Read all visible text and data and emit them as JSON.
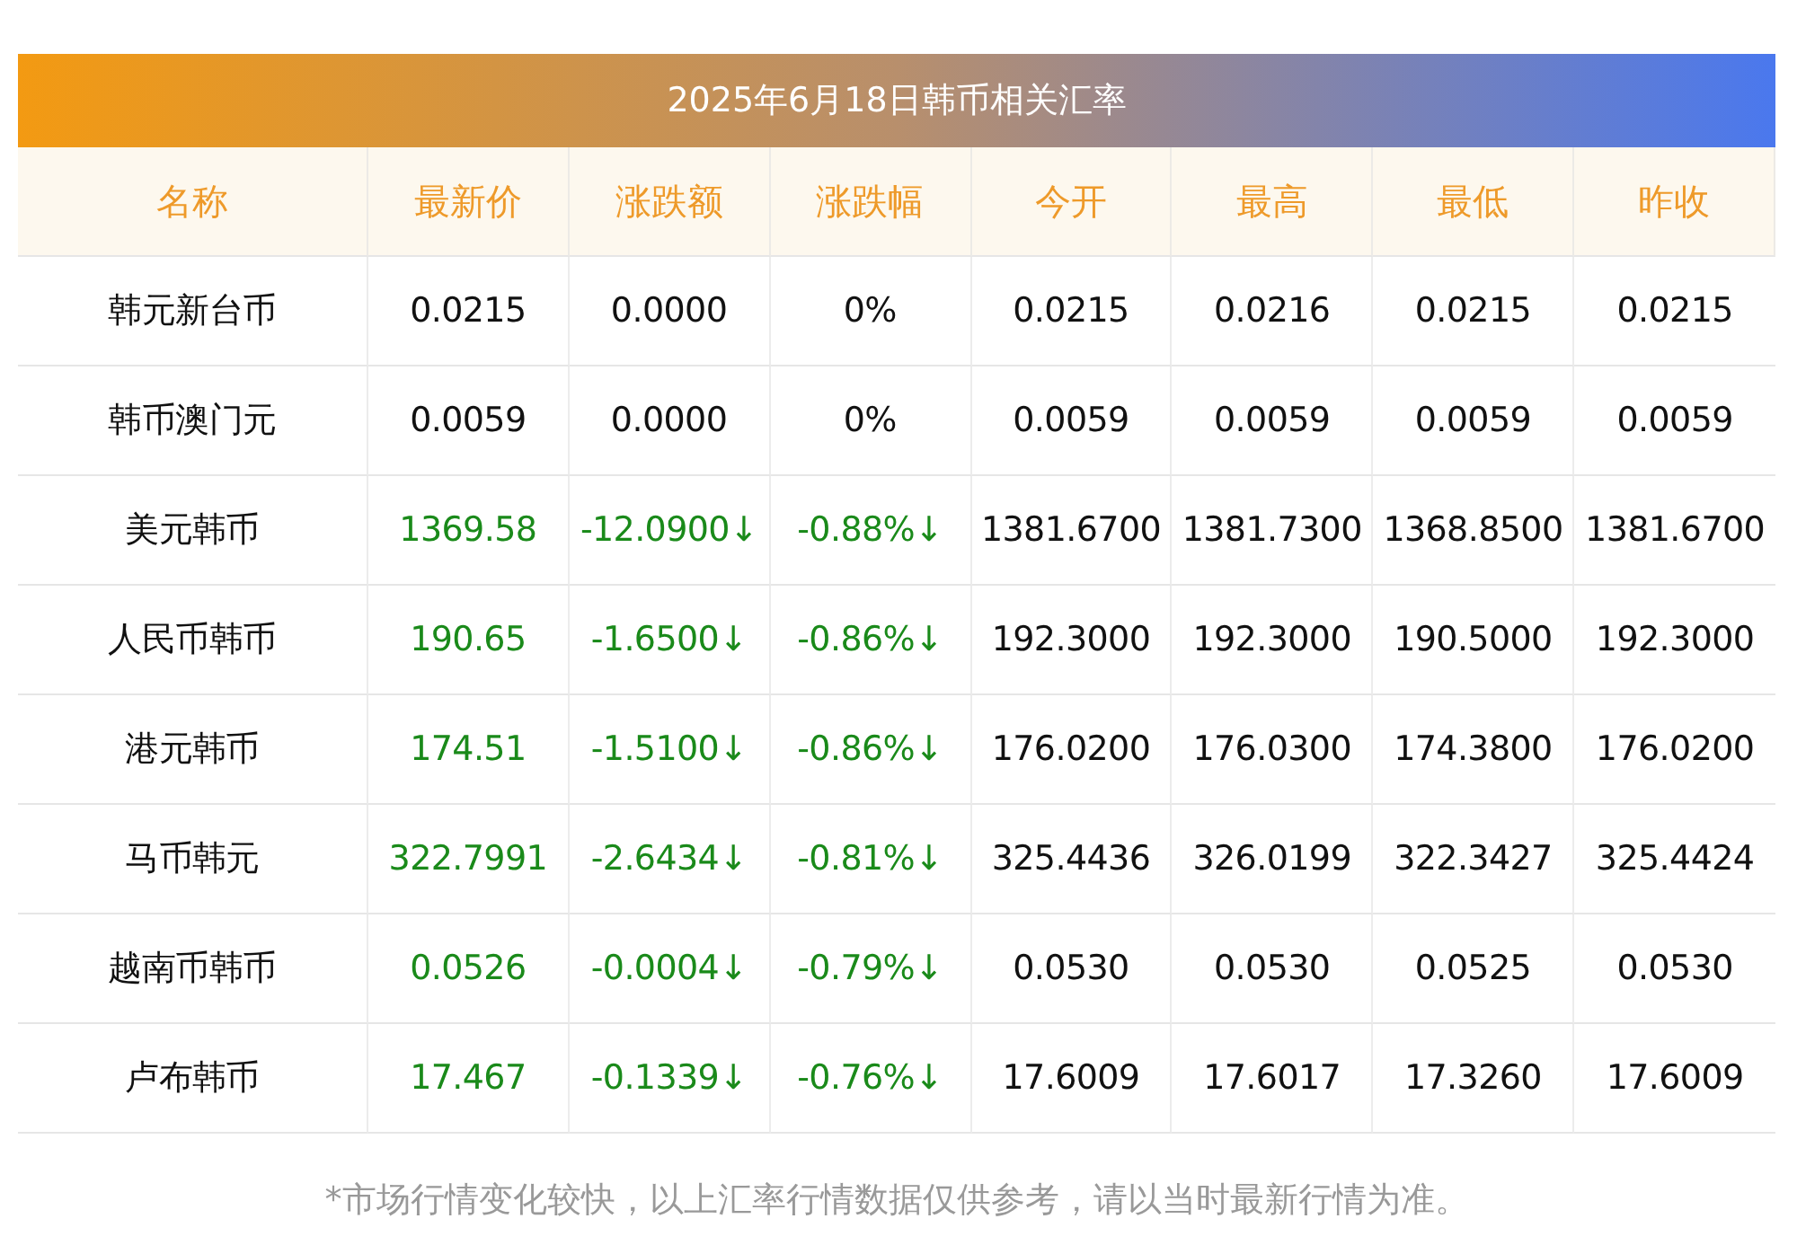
{
  "title": "2025年6月18日韩币相关汇率",
  "columns": [
    "名称",
    "最新价",
    "涨跌额",
    "涨跌幅",
    "今开",
    "最高",
    "最低",
    "昨收"
  ],
  "rows": [
    {
      "falling": false,
      "cells": [
        "韩元新台币",
        "0.0215",
        "0.0000",
        "0%",
        "0.0215",
        "0.0216",
        "0.0215",
        "0.0215"
      ]
    },
    {
      "falling": false,
      "cells": [
        "韩币澳门元",
        "0.0059",
        "0.0000",
        "0%",
        "0.0059",
        "0.0059",
        "0.0059",
        "0.0059"
      ]
    },
    {
      "falling": true,
      "cells": [
        "美元韩币",
        "1369.58",
        "-12.0900↓",
        "-0.88%↓",
        "1381.6700",
        "1381.7300",
        "1368.8500",
        "1381.6700"
      ]
    },
    {
      "falling": true,
      "cells": [
        "人民币韩币",
        "190.65",
        "-1.6500↓",
        "-0.86%↓",
        "192.3000",
        "192.3000",
        "190.5000",
        "192.3000"
      ]
    },
    {
      "falling": true,
      "cells": [
        "港元韩币",
        "174.51",
        "-1.5100↓",
        "-0.86%↓",
        "176.0200",
        "176.0300",
        "174.3800",
        "176.0200"
      ]
    },
    {
      "falling": true,
      "cells": [
        "马币韩元",
        "322.7991",
        "-2.6434↓",
        "-0.81%↓",
        "325.4436",
        "326.0199",
        "322.3427",
        "325.4424"
      ]
    },
    {
      "falling": true,
      "cells": [
        "越南币韩币",
        "0.0526",
        "-0.0004↓",
        "-0.79%↓",
        "0.0530",
        "0.0530",
        "0.0525",
        "0.0530"
      ]
    },
    {
      "falling": true,
      "cells": [
        "卢布韩币",
        "17.467",
        "-0.1339↓",
        "-0.76%↓",
        "17.6009",
        "17.6017",
        "17.3260",
        "17.6009"
      ]
    }
  ],
  "note": "*市场行情变化较快，以上汇率行情数据仅供参考，请以当时最新行情为准。"
}
